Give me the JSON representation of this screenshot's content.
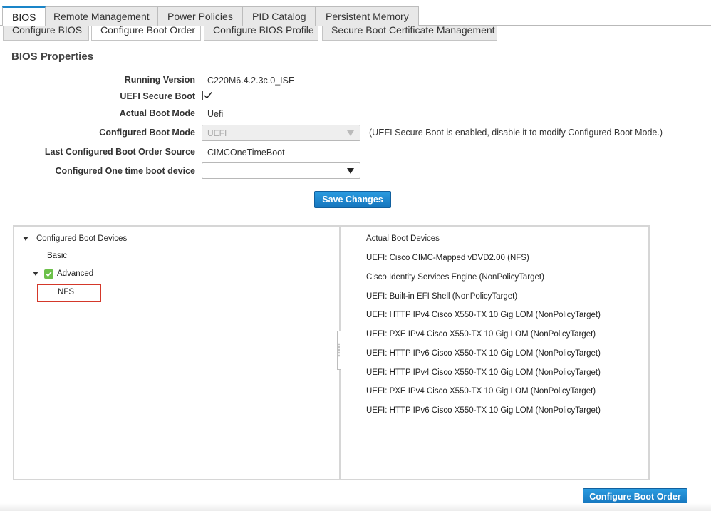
{
  "tabs_primary": [
    {
      "label": "BIOS",
      "active": true
    },
    {
      "label": "Remote Management",
      "active": false
    },
    {
      "label": "Power Policies",
      "active": false
    },
    {
      "label": "PID Catalog",
      "active": false
    },
    {
      "label": "Persistent Memory",
      "active": false
    }
  ],
  "tabs_secondary": [
    {
      "label": "Configure BIOS",
      "active": false
    },
    {
      "label": "Configure Boot Order",
      "active": true
    },
    {
      "label": "Configure BIOS Profile",
      "active": false
    },
    {
      "label": "Secure Boot Certificate Management",
      "active": false
    }
  ],
  "section_title": "BIOS Properties",
  "properties": {
    "running_version_label": "Running Version",
    "running_version_value": "C220M6.4.2.3c.0_ISE",
    "uefi_secure_boot_label": "UEFI Secure Boot",
    "uefi_secure_boot_checked": true,
    "actual_boot_mode_label": "Actual Boot Mode",
    "actual_boot_mode_value": "Uefi",
    "configured_boot_mode_label": "Configured Boot Mode",
    "configured_boot_mode_value": "UEFI",
    "configured_boot_mode_note": "(UEFI Secure Boot is enabled, disable it to modify Configured Boot Mode.)",
    "last_boot_order_source_label": "Last Configured Boot Order Source",
    "last_boot_order_source_value": "CIMCOneTimeBoot",
    "one_time_boot_device_label": "Configured One time boot device",
    "one_time_boot_device_value": ""
  },
  "save_changes_label": "Save Changes",
  "configured_tree": {
    "root_label": "Configured Boot Devices",
    "basic_label": "Basic",
    "advanced_label": "Advanced",
    "advanced_child": "NFS"
  },
  "actual_boot_devices": {
    "header": "Actual Boot Devices",
    "items": [
      "UEFI: Cisco CIMC-Mapped vDVD2.00 (NFS)",
      "Cisco Identity Services Engine (NonPolicyTarget)",
      "UEFI: Built-in EFI Shell (NonPolicyTarget)",
      "UEFI: HTTP IPv4 Cisco X550-TX 10 Gig LOM (NonPolicyTarget)",
      "UEFI: PXE IPv4 Cisco X550-TX 10 Gig LOM (NonPolicyTarget)",
      "UEFI: HTTP IPv6 Cisco X550-TX 10 Gig LOM (NonPolicyTarget)",
      "UEFI: HTTP IPv4 Cisco X550-TX 10 Gig LOM (NonPolicyTarget)",
      "UEFI: PXE IPv4 Cisco X550-TX 10 Gig LOM (NonPolicyTarget)",
      "UEFI: HTTP IPv6 Cisco X550-TX 10 Gig LOM (NonPolicyTarget)"
    ]
  },
  "configure_boot_order_label": "Configure Boot Order",
  "colors": {
    "accent": "#1a85c8",
    "button": "#1e88d1",
    "highlight": "#d4382a",
    "check_green": "#6cc04a"
  }
}
